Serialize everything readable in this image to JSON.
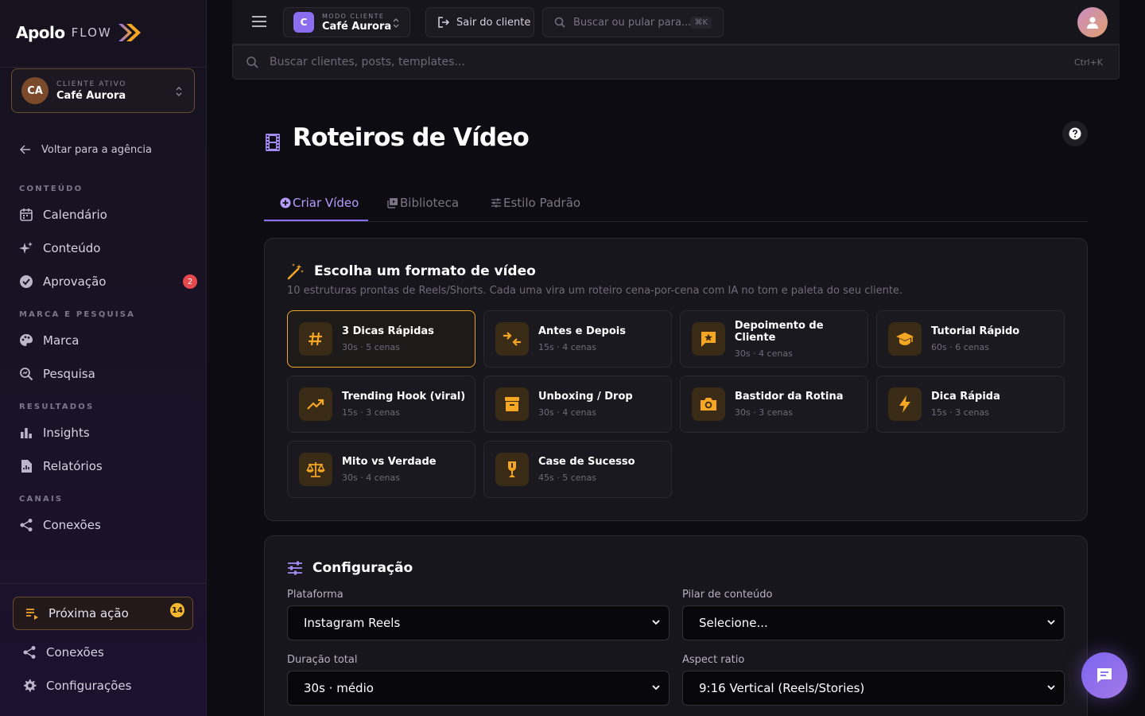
{
  "brand": {
    "name": "Apolo",
    "sub": "FLOW"
  },
  "client": {
    "kicker": "CLIENTE ATIVO",
    "initials": "CA",
    "name": "Café Aurora"
  },
  "sidebar": {
    "back": "Voltar para a agência",
    "sections": {
      "content": "CONTEÚDO",
      "brand": "MARCA E PESQUISA",
      "results": "RESULTADOS",
      "channels": "CANAIS"
    },
    "items": {
      "calendar": "Calendário",
      "content": "Conteúdo",
      "approval": "Aprovação",
      "approval_badge": "2",
      "brand": "Marca",
      "research": "Pesquisa",
      "insights": "Insights",
      "reports": "Relatórios",
      "connections": "Conexões"
    },
    "next_action": "Próxima ação",
    "next_action_badge": "14",
    "bottom_connections": "Conexões",
    "settings": "Configurações"
  },
  "topbar": {
    "mode_kicker": "MODO CLIENTE",
    "mode_initial": "C",
    "mode_name": "Café Aurora",
    "exit": "Sair do cliente",
    "jump_placeholder": "Buscar ou pular para...",
    "jump_kbd": "⌘K"
  },
  "search": {
    "placeholder": "Buscar clientes, posts, templates...",
    "kbd": "Ctrl+K"
  },
  "page": {
    "title": "Roteiros de Vídeo"
  },
  "tabs": {
    "create": "Criar Vídeo",
    "library": "Biblioteca",
    "style": "Estilo Padrão"
  },
  "formats": {
    "title": "Escolha um formato de vídeo",
    "desc": "10 estruturas prontas de Reels/Shorts. Cada uma vira um roteiro cena-por-cena com IA no tom e paleta do seu cliente.",
    "items": [
      {
        "name": "3 Dicas Rápidas",
        "meta": "30s · 5 cenas",
        "icon": "hash-icon"
      },
      {
        "name": "Antes e Depois",
        "meta": "15s · 4 cenas",
        "icon": "compare-arrows-icon"
      },
      {
        "name": "Depoimento de Cliente",
        "meta": "30s · 4 cenas",
        "icon": "review-star-icon"
      },
      {
        "name": "Tutorial Rápido",
        "meta": "60s · 6 cenas",
        "icon": "graduation-cap-icon"
      },
      {
        "name": "Trending Hook (viral)",
        "meta": "15s · 3 cenas",
        "icon": "trending-up-icon"
      },
      {
        "name": "Unboxing / Drop",
        "meta": "30s · 4 cenas",
        "icon": "archive-box-icon"
      },
      {
        "name": "Bastidor da Rotina",
        "meta": "30s · 3 cenas",
        "icon": "camera-icon"
      },
      {
        "name": "Dica Rápida",
        "meta": "15s · 3 cenas",
        "icon": "lightning-icon"
      },
      {
        "name": "Mito vs Verdade",
        "meta": "30s · 4 cenas",
        "icon": "scale-icon"
      },
      {
        "name": "Case de Sucesso",
        "meta": "45s · 5 cenas",
        "icon": "trophy-icon"
      }
    ]
  },
  "config": {
    "title": "Configuração",
    "platform_label": "Plataforma",
    "platform_value": "Instagram Reels",
    "pillar_label": "Pilar de conteúdo",
    "pillar_value": "Selecione...",
    "duration_label": "Duração total",
    "duration_value": "30s · médio",
    "aspect_label": "Aspect ratio",
    "aspect_value": "9:16 Vertical (Reels/Stories)"
  },
  "colors": {
    "accent": "#8b6df0",
    "highlight": "#f5a623",
    "danger": "#e5484d"
  }
}
